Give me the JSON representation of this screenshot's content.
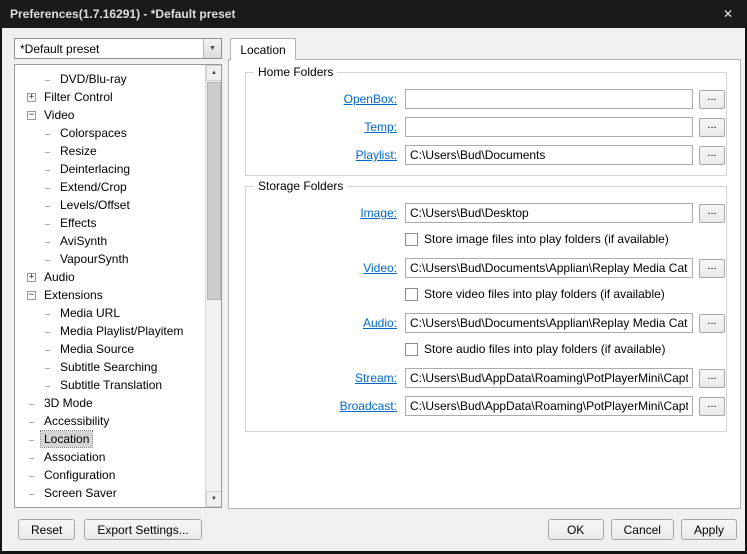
{
  "window": {
    "title": "Preferences(1.7.16291) -  *Default preset"
  },
  "icons": {
    "close": "✕",
    "combo_arrow": "▼",
    "scroll_up": "▲",
    "scroll_down": "▼"
  },
  "colors": {
    "titlebar": "#1a1a1a",
    "link": "#0066cc"
  },
  "preset": {
    "value": "*Default preset"
  },
  "tab": {
    "label": "Location"
  },
  "tree": {
    "items": [
      {
        "label": "DVD/Blu-ray",
        "level": 1,
        "expander": ""
      },
      {
        "label": "Filter Control",
        "level": 0,
        "expander": "+"
      },
      {
        "label": "Video",
        "level": 0,
        "expander": "−"
      },
      {
        "label": "Colorspaces",
        "level": 1,
        "expander": ""
      },
      {
        "label": "Resize",
        "level": 1,
        "expander": ""
      },
      {
        "label": "Deinterlacing",
        "level": 1,
        "expander": ""
      },
      {
        "label": "Extend/Crop",
        "level": 1,
        "expander": ""
      },
      {
        "label": "Levels/Offset",
        "level": 1,
        "expander": ""
      },
      {
        "label": "Effects",
        "level": 1,
        "expander": ""
      },
      {
        "label": "AviSynth",
        "level": 1,
        "expander": ""
      },
      {
        "label": "VapourSynth",
        "level": 1,
        "expander": ""
      },
      {
        "label": "Audio",
        "level": 0,
        "expander": "+"
      },
      {
        "label": "Extensions",
        "level": 0,
        "expander": "−"
      },
      {
        "label": "Media URL",
        "level": 1,
        "expander": ""
      },
      {
        "label": "Media Playlist/Playitem",
        "level": 1,
        "expander": ""
      },
      {
        "label": "Media Source",
        "level": 1,
        "expander": ""
      },
      {
        "label": "Subtitle Searching",
        "level": 1,
        "expander": ""
      },
      {
        "label": "Subtitle Translation",
        "level": 1,
        "expander": ""
      },
      {
        "label": "3D Mode",
        "level": 0,
        "expander": ""
      },
      {
        "label": "Accessibility",
        "level": 0,
        "expander": ""
      },
      {
        "label": "Location",
        "level": 0,
        "expander": "",
        "selected": true
      },
      {
        "label": "Association",
        "level": 0,
        "expander": ""
      },
      {
        "label": "Configuration",
        "level": 0,
        "expander": ""
      },
      {
        "label": "Screen Saver",
        "level": 0,
        "expander": ""
      }
    ]
  },
  "home_folders": {
    "title": "Home Folders",
    "rows": [
      {
        "label": "OpenBox:",
        "value": "",
        "browse": "..."
      },
      {
        "label": "Temp:",
        "value": "",
        "browse": "..."
      },
      {
        "label": "Playlist:",
        "value": "C:\\Users\\Bud\\Documents",
        "browse": "..."
      }
    ]
  },
  "storage_folders": {
    "title": "Storage Folders",
    "rows": [
      {
        "label": "Image:",
        "value": "C:\\Users\\Bud\\Desktop",
        "browse": "...",
        "checkbox": "Store image files into play folders (if available)"
      },
      {
        "label": "Video:",
        "value": "C:\\Users\\Bud\\Documents\\Applian\\Replay Media Catc",
        "browse": "...",
        "checkbox": "Store video files into play folders (if available)"
      },
      {
        "label": "Audio:",
        "value": "C:\\Users\\Bud\\Documents\\Applian\\Replay Media Catc",
        "browse": "...",
        "checkbox": "Store audio files into play folders (if available)"
      },
      {
        "label": "Stream:",
        "value": "C:\\Users\\Bud\\AppData\\Roaming\\PotPlayerMini\\Captu",
        "browse": "..."
      },
      {
        "label": "Broadcast:",
        "value": "C:\\Users\\Bud\\AppData\\Roaming\\PotPlayerMini\\Captu",
        "browse": "..."
      }
    ]
  },
  "footer": {
    "reset": "Reset",
    "export": "Export Settings...",
    "ok": "OK",
    "cancel": "Cancel",
    "apply": "Apply"
  }
}
